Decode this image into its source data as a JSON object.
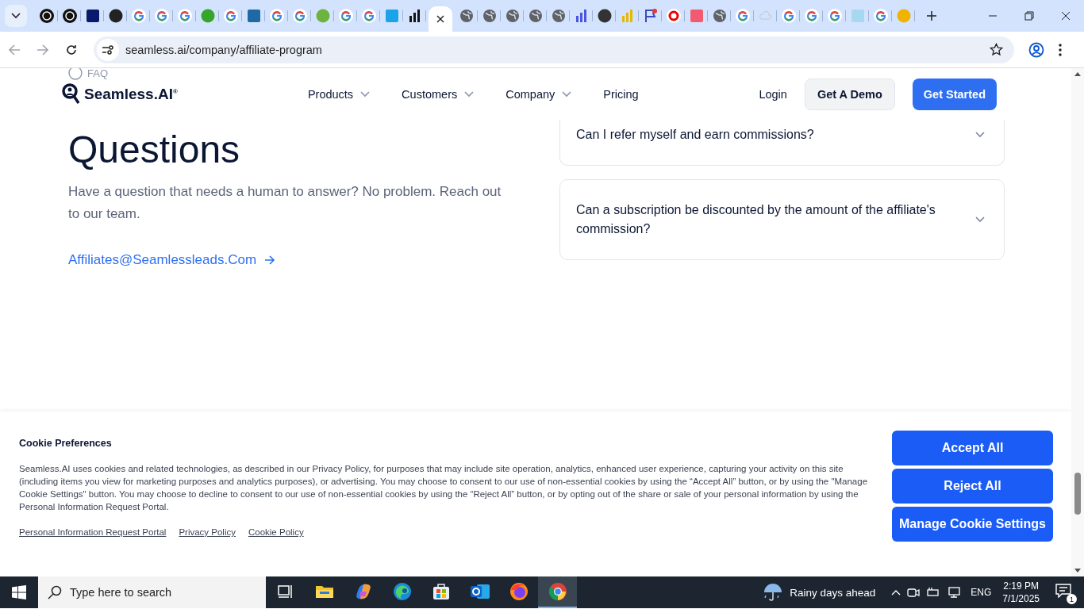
{
  "browser": {
    "tabs": [
      {
        "kind": "openai",
        "selected": false
      },
      {
        "kind": "openai",
        "selected": false
      },
      {
        "kind": "square",
        "color": "#0a1a6b",
        "selected": false
      },
      {
        "kind": "circle",
        "color": "#222222",
        "selected": false
      },
      {
        "kind": "google",
        "selected": false
      },
      {
        "kind": "google",
        "selected": false
      },
      {
        "kind": "google",
        "selected": false
      },
      {
        "kind": "circle",
        "color": "#35a52b",
        "selected": false
      },
      {
        "kind": "google",
        "selected": false
      },
      {
        "kind": "square",
        "color": "#1f6aa5",
        "selected": false
      },
      {
        "kind": "google",
        "selected": false
      },
      {
        "kind": "google",
        "selected": false
      },
      {
        "kind": "circle",
        "color": "#6db33f",
        "selected": false
      },
      {
        "kind": "google",
        "selected": false
      },
      {
        "kind": "google",
        "selected": false
      },
      {
        "kind": "square",
        "color": "#1aa3e8",
        "selected": false
      },
      {
        "kind": "bars",
        "color": "#111111",
        "selected": false
      },
      {
        "kind": "page",
        "selected": true
      },
      {
        "kind": "globe",
        "selected": false
      },
      {
        "kind": "globe",
        "selected": false
      },
      {
        "kind": "globe",
        "selected": false
      },
      {
        "kind": "globe",
        "selected": false
      },
      {
        "kind": "globe",
        "selected": false
      },
      {
        "kind": "bars",
        "color": "#4a55e0",
        "selected": false
      },
      {
        "kind": "circle",
        "color": "#333333",
        "selected": false
      },
      {
        "kind": "bars",
        "color": "#e6b800",
        "selected": false
      },
      {
        "kind": "flag",
        "selected": false
      },
      {
        "kind": "ring",
        "selected": false
      },
      {
        "kind": "square",
        "color": "#f25a70",
        "selected": false
      },
      {
        "kind": "globe",
        "selected": false
      },
      {
        "kind": "google",
        "selected": false
      },
      {
        "kind": "cloud",
        "selected": false
      },
      {
        "kind": "google",
        "selected": false
      },
      {
        "kind": "google",
        "selected": false
      },
      {
        "kind": "google",
        "selected": false
      },
      {
        "kind": "square",
        "color": "#a8d8f0",
        "selected": false
      },
      {
        "kind": "google",
        "selected": false
      },
      {
        "kind": "circle",
        "color": "#f0b400",
        "selected": false
      }
    ],
    "address": "seamless.ai/company/affiliate-program"
  },
  "header": {
    "logo": "Seamless.AI$^{®}$",
    "nav": [
      {
        "label": "Products",
        "dropdown": true
      },
      {
        "label": "Customers",
        "dropdown": true
      },
      {
        "label": "Company",
        "dropdown": true
      },
      {
        "label": "Pricing",
        "dropdown": false
      }
    ],
    "login": "Login",
    "demo": "Get A Demo",
    "start": "Get Started"
  },
  "faq": {
    "badge": "FAQ",
    "heading": "Questions",
    "intro": "Have a question that needs a human to answer? No problem. Reach out to our team.",
    "email": "Affiliates@Seamlessleads.Com",
    "questions": [
      {
        "text": "Can I refer myself and earn commissions?",
        "expanded": false
      },
      {
        "text": "Can a subscription be discounted by the amount of the affiliate's commission?",
        "expanded": false
      }
    ]
  },
  "cookie": {
    "title": "Cookie Preferences",
    "text": "Seamless.AI uses cookies and related technologies, as described in our Privacy Policy, for purposes that may include site operation, analytics, enhanced user experience, capturing your activity on this site (including items you view for marketing purposes and analytics purposes), or advertising. You may choose to consent to our use of non-essential cookies by using the “Accept All” button, or by using the \"Manage Cookie Settings\" button. You may choose to decline to consent to our use of non-essential cookies by using the “Reject All” button, or by opting out of the share or sale of your personal information by using the Personal Information Request Portal.",
    "links": [
      "Personal Information Request Portal",
      "Privacy Policy",
      "Cookie Policy"
    ],
    "buttons": [
      "Accept All",
      "Reject All",
      "Manage Cookie Settings"
    ]
  },
  "taskbar": {
    "search_placeholder": "Type here to search",
    "apps": [
      {
        "kind": "taskview",
        "selected": false
      },
      {
        "kind": "folder",
        "selected": false
      },
      {
        "kind": "copilot",
        "selected": false
      },
      {
        "kind": "edge",
        "selected": false
      },
      {
        "kind": "store",
        "selected": false
      },
      {
        "kind": "outlook",
        "selected": false
      },
      {
        "kind": "firefox",
        "selected": false
      },
      {
        "kind": "chrome",
        "selected": true
      }
    ],
    "weather": "Rainy days ahead",
    "language": "ENG",
    "time": "2:19 PM",
    "date": "7/1/2025",
    "notifications": "1"
  }
}
